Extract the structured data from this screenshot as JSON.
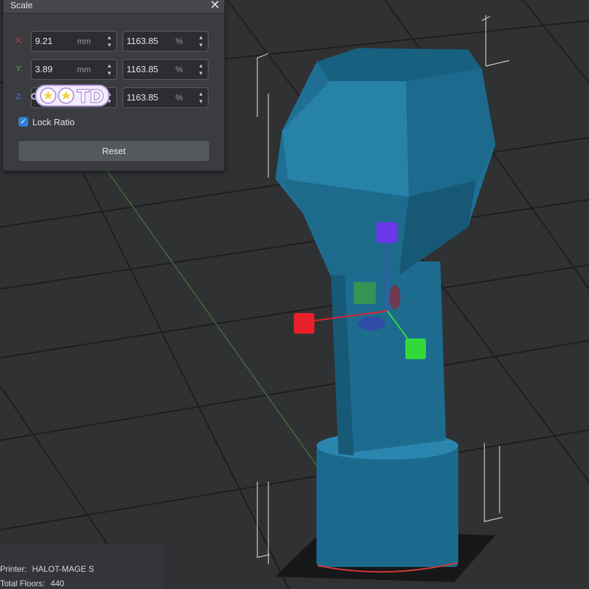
{
  "panel": {
    "title": "Scale",
    "close_glyph": "✕",
    "rows": [
      {
        "axis": "X:",
        "axis_color": "#e04040",
        "mm": "9.21",
        "mm_unit": "mm",
        "pct": "1163.85",
        "pct_unit": "%"
      },
      {
        "axis": "Y:",
        "axis_color": "#3fbf3f",
        "mm": "3.89",
        "mm_unit": "mm",
        "pct": "1163.85",
        "pct_unit": "%"
      },
      {
        "axis": "Z:",
        "axis_color": "#3c7fe0",
        "mm": "",
        "mm_unit": "",
        "pct": "1163.85",
        "pct_unit": "%"
      }
    ],
    "lock_ratio_label": "Lock Ratio",
    "lock_ratio_checked": true,
    "reset_label": "Reset"
  },
  "overlay": {
    "keychain_text": "TD"
  },
  "info": {
    "printer_label": "Printer:",
    "printer_value": "HALOT-MAGE S",
    "floors_label": "Total Floors:",
    "floors_value": "440"
  },
  "colors": {
    "model": "#1f6f94",
    "gizmo_x": "#e8202a",
    "gizmo_y": "#33d93a",
    "gizmo_z": "#6a38e8"
  }
}
